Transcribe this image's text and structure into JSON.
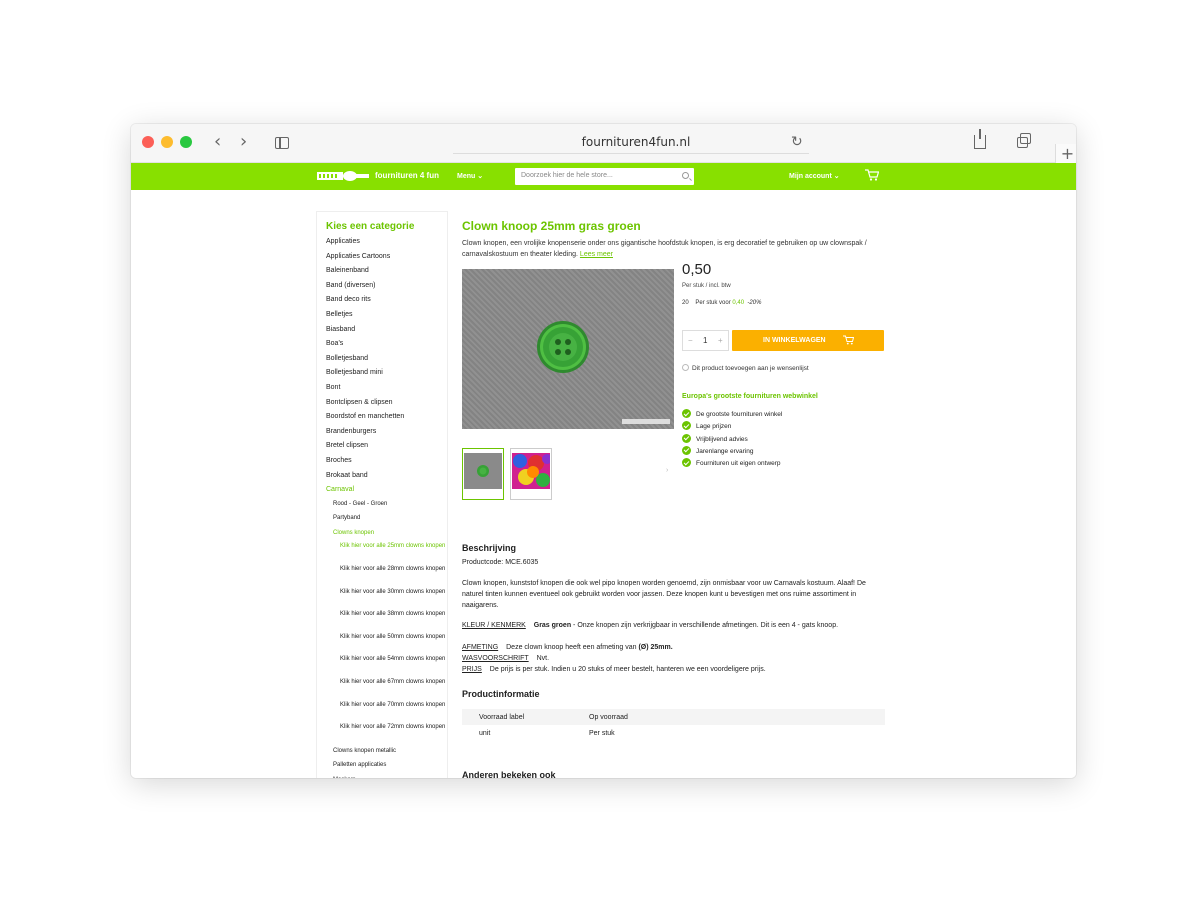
{
  "browser": {
    "url": "fournituren4fun.nl",
    "back_glyph": "‹",
    "forward_glyph": "›",
    "reload_glyph": "↻",
    "new_tab_glyph": "+"
  },
  "header": {
    "logo_text": "fournituren 4 fun",
    "menu_label": "Menu ⌄",
    "search_placeholder": "Doorzoek hier de hele store...",
    "account_label": "Mijn account ⌄"
  },
  "categories": {
    "title": "Kies een categorie",
    "items": [
      {
        "label": "Applicaties",
        "level": 0,
        "active": false
      },
      {
        "label": "Applicaties Cartoons",
        "level": 0,
        "active": false
      },
      {
        "label": "Baleinenband",
        "level": 0,
        "active": false
      },
      {
        "label": "Band (diversen)",
        "level": 0,
        "active": false
      },
      {
        "label": "Band deco rits",
        "level": 0,
        "active": false
      },
      {
        "label": "Belletjes",
        "level": 0,
        "active": false
      },
      {
        "label": "Biasband",
        "level": 0,
        "active": false
      },
      {
        "label": "Boa's",
        "level": 0,
        "active": false
      },
      {
        "label": "Bolletjesband",
        "level": 0,
        "active": false
      },
      {
        "label": "Bolletjesband mini",
        "level": 0,
        "active": false
      },
      {
        "label": "Bont",
        "level": 0,
        "active": false
      },
      {
        "label": "Bontclipsen & clipsen",
        "level": 0,
        "active": false
      },
      {
        "label": "Boordstof en manchetten",
        "level": 0,
        "active": false
      },
      {
        "label": "Brandenburgers",
        "level": 0,
        "active": false
      },
      {
        "label": "Bretel clipsen",
        "level": 0,
        "active": false
      },
      {
        "label": "Broches",
        "level": 0,
        "active": false
      },
      {
        "label": "Brokaat band",
        "level": 0,
        "active": false
      },
      {
        "label": "Carnaval",
        "level": 0,
        "active": true
      },
      {
        "label": "Rood - Geel - Groen",
        "level": 1,
        "active": false
      },
      {
        "label": "Partyband",
        "level": 1,
        "active": false
      },
      {
        "label": "Clowns knopen",
        "level": 1,
        "active": true
      },
      {
        "label": "Klik hier voor alle 25mm clowns knopen",
        "level": 2,
        "active": true
      },
      {
        "label": "Klik hier voor alle 28mm clowns knopen",
        "level": 2,
        "active": false
      },
      {
        "label": "Klik hier voor alle 30mm clowns knopen",
        "level": 2,
        "active": false
      },
      {
        "label": "Klik hier voor alle 38mm clowns knopen",
        "level": 2,
        "active": false
      },
      {
        "label": "Klik hier voor alle 50mm clowns knopen",
        "level": 2,
        "active": false
      },
      {
        "label": "Klik hier voor alle 54mm clowns knopen",
        "level": 2,
        "active": false
      },
      {
        "label": "Klik hier voor alle 67mm clowns knopen",
        "level": 2,
        "active": false
      },
      {
        "label": "Klik hier voor alle 70mm clowns knopen",
        "level": 2,
        "active": false
      },
      {
        "label": "Klik hier voor alle 72mm clowns knopen",
        "level": 2,
        "active": false
      },
      {
        "label": "Clowns knopen metallic",
        "level": 1,
        "active": false
      },
      {
        "label": "Palletten applicaties",
        "level": 1,
        "active": false
      },
      {
        "label": "Maskers",
        "level": 1,
        "active": false
      }
    ]
  },
  "product": {
    "title": "Clown knoop 25mm gras groen",
    "intro": "Clown knopen, een vrolijke knopenserie onder ons gigantische hoofdstuk knopen, is erg decoratief te gebruiken op uw clownspak / carnavalskostuum en theater kleding.",
    "read_more": "Lees meer",
    "price": "0,50",
    "price_note": "Per stuk / incl. btw",
    "tier_qty": "20",
    "tier_label": "Per stuk voor",
    "tier_price": "0,40",
    "tier_discount": "-20%",
    "quantity": "1",
    "qty_minus": "−",
    "qty_plus": "+",
    "cart_button": "IN WINKELWAGEN",
    "wishlist": "Dit product toevoegen aan je wensenlijst",
    "usp_title": "Europa's grootste fournituren webwinkel",
    "usps": [
      "De grootste fournituren winkel",
      "Lage prijzen",
      "Vrijblijvend advies",
      "Jarenlange ervaring",
      "Fournituren uit eigen ontwerp"
    ],
    "thumb_next": "›"
  },
  "description": {
    "title": "Beschrijving",
    "code": "Productcode: MCE.6035",
    "paragraph": "Clown knopen, kunststof knopen die ook wel pipo knopen worden genoemd, zijn onmisbaar voor uw Carnavals kostuum. Alaaf! De naturel tinten kunnen eventueel ook gebruikt worden voor jassen. Deze knopen kunt u bevestigen met ons ruime assortiment in naaigarens.",
    "kleur_key": "KLEUR / KENMERK",
    "kleur_bold": "Gras groen",
    "kleur_rest": " - Onze knopen zijn verkrijgbaar in verschillende afmetingen. Dit is een 4 - gats knoop.",
    "afmeting_key": "AFMETING",
    "afmeting_text": "Deze clown knoop heeft een afmeting van ",
    "afmeting_bold": "(Ø) 25mm.",
    "was_key": "WASVOORSCHRIFT",
    "was_text": "Nvt.",
    "prijs_key": "PRIJS",
    "prijs_text": "De prijs is per stuk. Indien u 20 stuks of meer bestelt, hanteren we een voordeligere prijs."
  },
  "product_info": {
    "title": "Productinformatie",
    "rows": [
      {
        "key": "Voorraad label",
        "value": "Op voorraad"
      },
      {
        "key": "unit",
        "value": "Per stuk"
      }
    ]
  },
  "related": {
    "title": "Anderen bekeken ook"
  },
  "colors": {
    "brand_green": "#88e000",
    "accent_green": "#6cc400",
    "cart_orange": "#fbb000"
  }
}
